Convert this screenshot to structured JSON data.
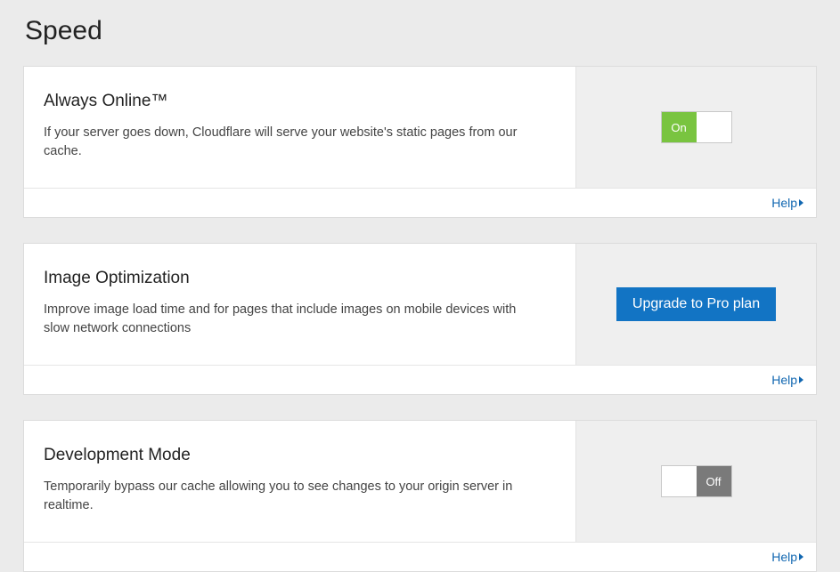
{
  "page_title": "Speed",
  "help_label": "Help",
  "toggle_on_label": "On",
  "toggle_off_label": "Off",
  "settings": {
    "always_online": {
      "title": "Always Online™",
      "desc": "If your server goes down, Cloudflare will serve your website's static pages from our cache.",
      "state": "on"
    },
    "image_optimization": {
      "title": "Image Optimization",
      "desc": "Improve image load time and for pages that include images on mobile devices with slow network connections",
      "upgrade_label": "Upgrade to Pro plan"
    },
    "development_mode": {
      "title": "Development Mode",
      "desc": "Temporarily bypass our cache allowing you to see changes to your origin server in realtime.",
      "state": "off"
    }
  }
}
